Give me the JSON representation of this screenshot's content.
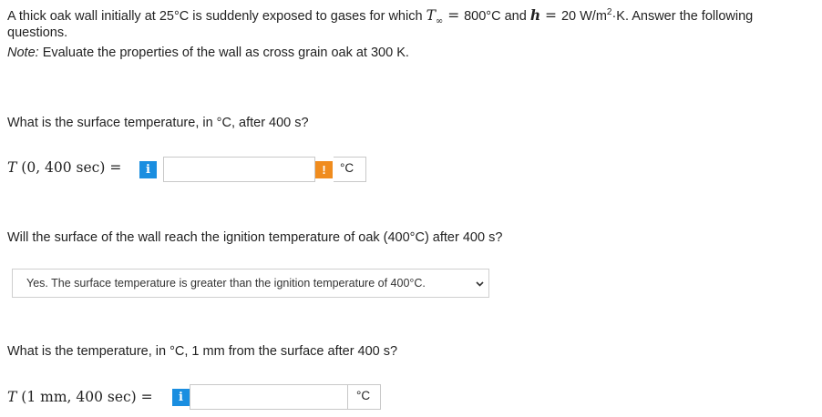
{
  "intro": {
    "line1_a": "A thick oak wall initially at 25°C is suddenly exposed to gases for which",
    "t_inf_symbol": "T",
    "t_inf_sub": "∞",
    "eq1": " = ",
    "t_inf_value": "800°C and",
    "h_symbol": "h",
    "eq2": " = ",
    "h_value": "20 W/m",
    "h_sup": "2",
    "h_unit_rest": "·K. Answer the following",
    "line2": "questions.",
    "note_label": "Note:",
    "note_text": " Evaluate the properties of the wall as cross grain oak at 300 K."
  },
  "q1": {
    "question": "What is the surface temperature, in °C, after 400 s?",
    "lhs_T": "T",
    "lhs_args": "(0, 400  sec) =",
    "info": "i",
    "input_value": "",
    "warn": "!",
    "unit": "°C"
  },
  "q2": {
    "question": "Will the surface of the wall reach the ignition temperature of oak (400°C) after 400 s?",
    "selected": "Yes. The surface temperature is greater than the ignition temperature of 400°C."
  },
  "q3": {
    "question": "What is the temperature, in °C, 1 mm from the surface after 400 s?",
    "lhs_T": "T",
    "lhs_args": "(1  mm, 400  sec) =",
    "info": "i",
    "input_value": "",
    "unit": "°C"
  },
  "colors": {
    "info_blue": "#1a8ee0",
    "warn_orange": "#f08c1e",
    "text": "#222222"
  }
}
